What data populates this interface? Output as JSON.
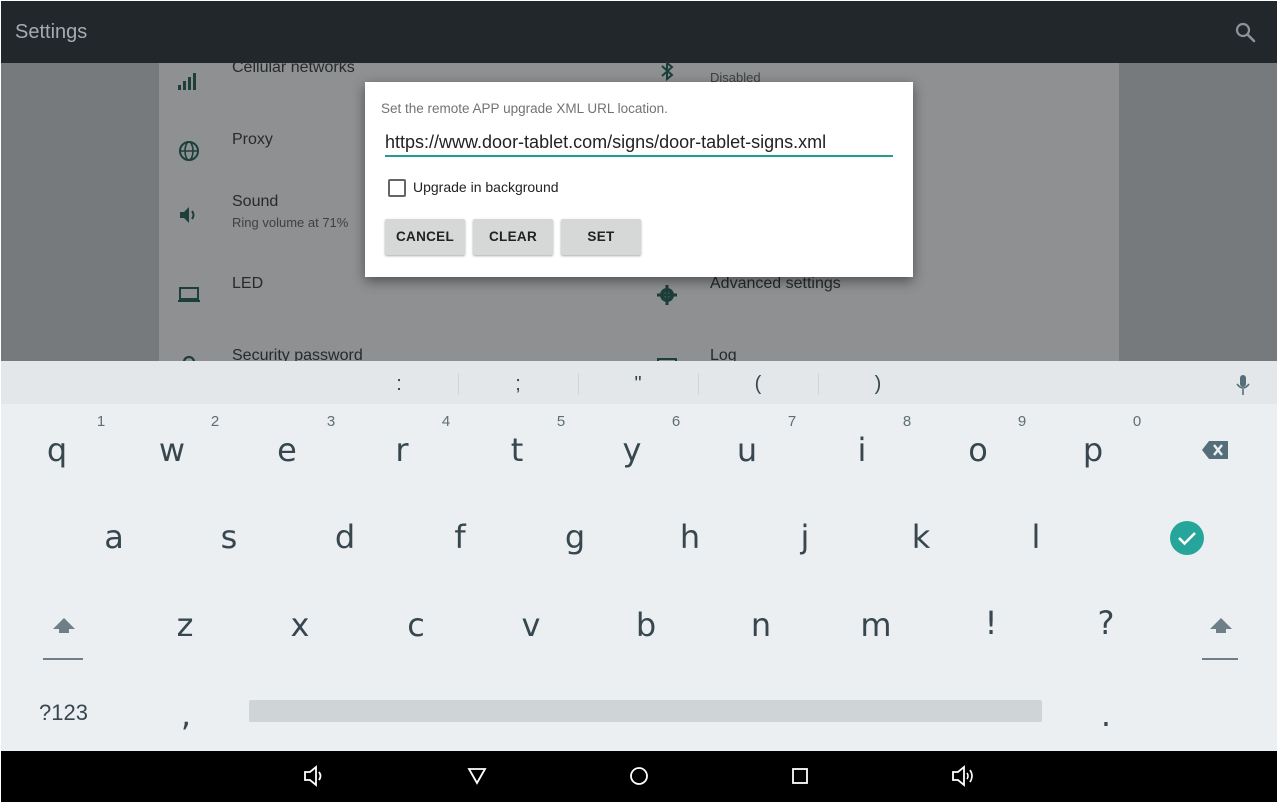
{
  "appbar": {
    "title": "Settings",
    "search_icon": "search-icon"
  },
  "settings": {
    "left": [
      {
        "label": "Cellular networks",
        "sub": "",
        "icon": "signal-icon"
      },
      {
        "label": "Proxy",
        "sub": "",
        "icon": "globe-icon"
      },
      {
        "label": "Sound",
        "sub": "Ring volume at 71%",
        "icon": "volume-icon"
      },
      {
        "label": "LED",
        "sub": "",
        "icon": "laptop-icon"
      },
      {
        "label": "Security password",
        "sub": "",
        "icon": "lock-icon"
      }
    ],
    "right": [
      {
        "label": "",
        "sub": "Disabled",
        "icon": "bluetooth-icon"
      },
      {
        "label": "Advanced settings",
        "sub": "",
        "icon": "gear-icon"
      },
      {
        "label": "Log",
        "sub": "",
        "icon": "log-icon"
      }
    ]
  },
  "dialog": {
    "message": "Set the remote APP upgrade XML URL location.",
    "url_value": "https://www.door-tablet.com/signs/door-tablet-signs.xml",
    "checkbox_label": "Upgrade in background",
    "checkbox_checked": false,
    "buttons": {
      "cancel": "CANCEL",
      "clear": "CLEAR",
      "set": "SET"
    }
  },
  "keyboard": {
    "suggestions": [
      ":",
      ";",
      "\"",
      "(",
      ")"
    ],
    "row1": [
      "q",
      "w",
      "e",
      "r",
      "t",
      "y",
      "u",
      "i",
      "o",
      "p"
    ],
    "row1_hints": [
      "1",
      "2",
      "3",
      "4",
      "5",
      "6",
      "7",
      "8",
      "9",
      "0"
    ],
    "row2": [
      "a",
      "s",
      "d",
      "f",
      "g",
      "h",
      "j",
      "k",
      "l"
    ],
    "row3": [
      "z",
      "x",
      "c",
      "v",
      "b",
      "n",
      "m",
      "!",
      "?"
    ],
    "symbols_key": "?123",
    "comma": ",",
    "period": ".",
    "accent_color": "#26a69a"
  },
  "colors": {
    "appbar": "#21272b",
    "input_underline": "#1f9e8f",
    "keyboard_bg": "#eceff1"
  }
}
